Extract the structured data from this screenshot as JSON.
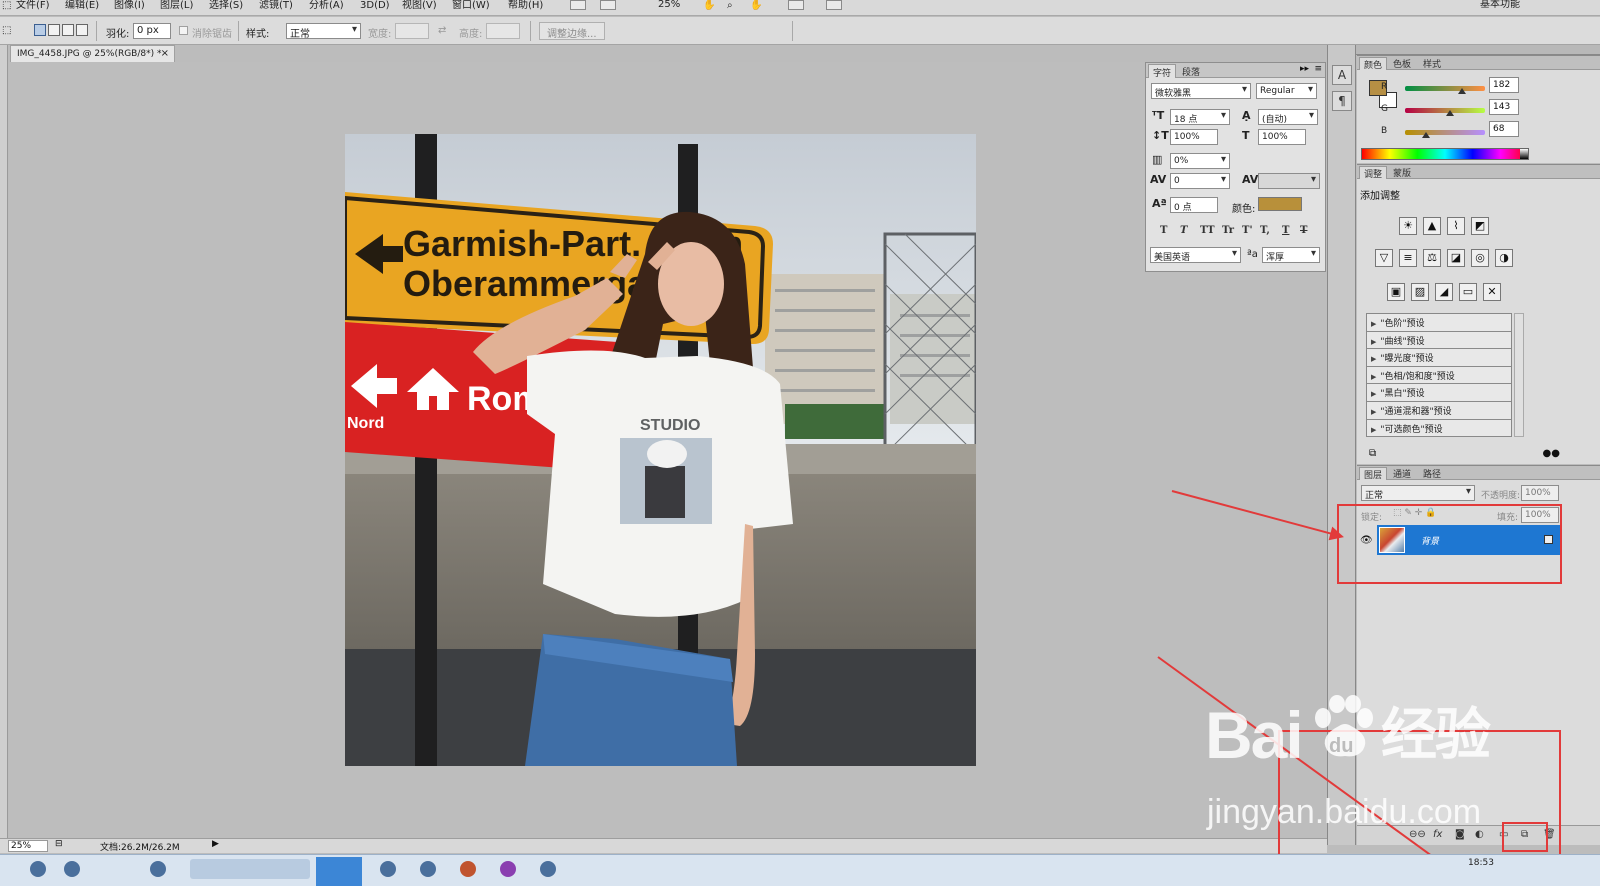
{
  "menu": {
    "items": [
      "文件(F)",
      "编辑(E)",
      "图像(I)",
      "图层(L)",
      "选择(S)",
      "滤镜(T)",
      "分析(A)",
      "3D(D)",
      "视图(V)",
      "窗口(W)",
      "帮助(H)"
    ],
    "zoom": "25%",
    "workspace": "基本功能"
  },
  "options": {
    "feather_label": "羽化:",
    "feather_value": "0 px",
    "antialias_label": "消除锯齿",
    "style_label": "样式:",
    "style_value": "正常",
    "width_label": "宽度:",
    "height_label": "高度:",
    "refine_edge": "调整边缘..."
  },
  "document": {
    "tab_title": "IMG_4458.JPG @ 25%(RGB/8*) *",
    "close": "×",
    "sign_yellow_line1": "Garmish-Part. 46km",
    "sign_yellow_line2": "Oberammergau",
    "sign_red_text": "Romantic",
    "sign_red_sub": "Nord",
    "shirt_text": "STUDIO"
  },
  "status": {
    "zoom": "25%",
    "doc_info": "文档:26.2M/26.2M"
  },
  "character_panel": {
    "tabs": [
      "字符",
      "段落"
    ],
    "font_family": "微软雅黑",
    "font_style": "Regular",
    "font_size": "18 点",
    "leading": "(自动)",
    "vertical_scale": "100%",
    "horizontal_scale": "100%",
    "tracking_ratio": "0%",
    "kerning": "0",
    "baseline_shift": "0 点",
    "color_label": "颜色:",
    "color_hex": "#b8903a",
    "type_buttons": [
      "T",
      "T",
      "TT",
      "Tr",
      "T'",
      "T,",
      "T",
      "T"
    ],
    "language": "美国英语",
    "antialias_label": "ªa",
    "antialias": "浑厚"
  },
  "color_panel": {
    "tabs": [
      "颜色",
      "色板",
      "样式"
    ],
    "r_label": "R",
    "g_label": "G",
    "b_label": "B",
    "r": "182",
    "g": "143",
    "b": "68",
    "r_fraction": 0.714,
    "g_fraction": 0.561,
    "b_fraction": 0.267,
    "foreground": "#b68f44"
  },
  "adjustments_panel": {
    "tabs": [
      "调整",
      "蒙版"
    ],
    "title": "添加调整",
    "presets": [
      "\"色阶\"预设",
      "\"曲线\"预设",
      "\"曝光度\"预设",
      "\"色相/饱和度\"预设",
      "\"黑白\"预设",
      "\"通道混和器\"预设",
      "\"可选颜色\"预设"
    ]
  },
  "layers_panel": {
    "tabs": [
      "图层",
      "通道",
      "路径"
    ],
    "blend_mode": "正常",
    "opacity_label": "不透明度:",
    "opacity": "100%",
    "lock_label": "锁定:",
    "fill_label": "填充:",
    "fill": "100%",
    "layer_name": "背景"
  },
  "taskbar": {
    "clock": "18:53"
  },
  "watermark": {
    "brand": "Bai",
    "brand2": "经验",
    "brand_du": "du",
    "url": "jingyan.baidu.com"
  },
  "accent": "#1e77d2",
  "annotation_color": "#e23a3a"
}
